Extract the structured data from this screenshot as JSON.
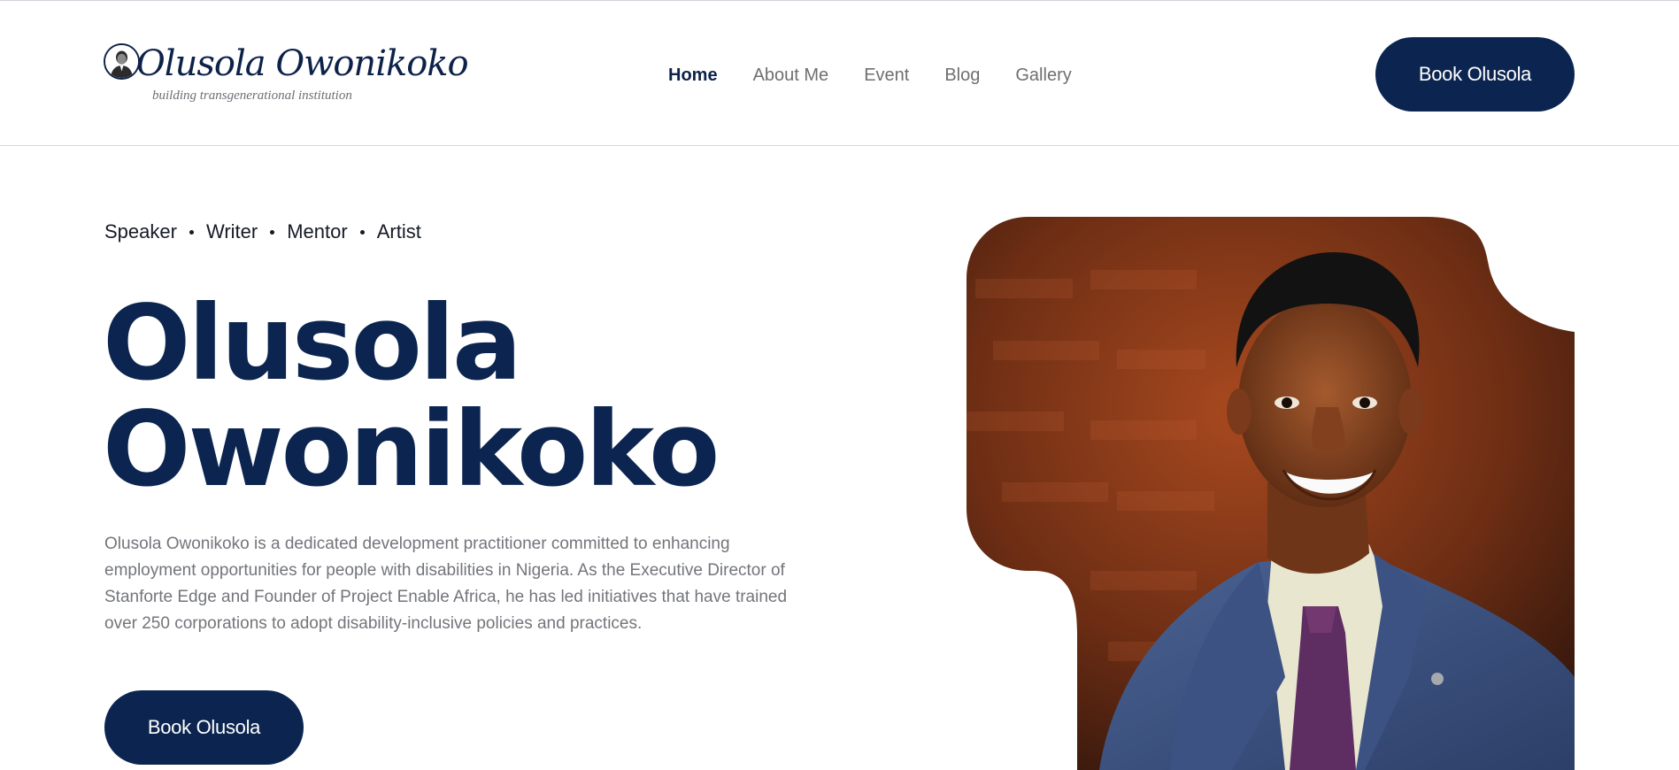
{
  "site": {
    "logo_name": "Olusola Owonikoko",
    "logo_tagline": "building transgenerational institution"
  },
  "nav": {
    "items": [
      {
        "label": "Home",
        "active": true
      },
      {
        "label": "About Me",
        "active": false
      },
      {
        "label": "Event",
        "active": false
      },
      {
        "label": "Blog",
        "active": false
      },
      {
        "label": "Gallery",
        "active": false
      }
    ]
  },
  "header": {
    "cta_label": "Book Olusola"
  },
  "hero": {
    "roles": [
      "Speaker",
      "Writer",
      "Mentor",
      "Artist"
    ],
    "title_line1": "Olusola",
    "title_line2": "Owonikoko",
    "bio": "Olusola Owonikoko is a dedicated development practitioner committed to enhancing employment opportunities for people with disabilities in Nigeria. As the Executive Director of Stanforte Edge and Founder of Project Enable Africa, he has led initiatives that have trained over 250 corporations to adopt disability-inclusive policies and practices.",
    "cta_label": "Book Olusola"
  },
  "colors": {
    "brand_navy": "#0c2550",
    "nav_inactive": "#6f6f70",
    "body_text": "#73757b"
  },
  "icons": {
    "logo_avatar": "portrait-avatar-icon"
  }
}
